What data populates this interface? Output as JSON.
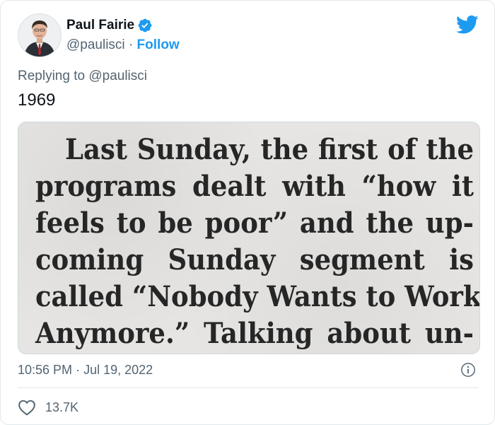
{
  "user": {
    "display_name": "Paul Fairie",
    "handle": "@paulisci",
    "separator": "·",
    "follow_label": "Follow"
  },
  "reply": {
    "prefix": "Replying to",
    "to_handle": "@paulisci"
  },
  "tweet": {
    "text": "1969"
  },
  "clipping": {
    "lines": [
      "Last Sunday, the first of the",
      "programs dealt with “how it",
      "feels to be poor” and the up-",
      "coming Sunday segment is",
      "called “Nobody Wants to Work",
      "Anymore.” Talking about un-"
    ]
  },
  "meta": {
    "time": "10:56 PM",
    "dot": "·",
    "date": "Jul 19, 2022"
  },
  "engagement": {
    "likes": "13.7K"
  },
  "colors": {
    "accent": "#1d9bf0",
    "secondary_text": "#536471",
    "border": "#e1e8ed"
  },
  "icons": {
    "verified": "verified-badge-icon",
    "logo": "twitter-bird-icon",
    "info": "info-icon",
    "like": "heart-icon"
  }
}
